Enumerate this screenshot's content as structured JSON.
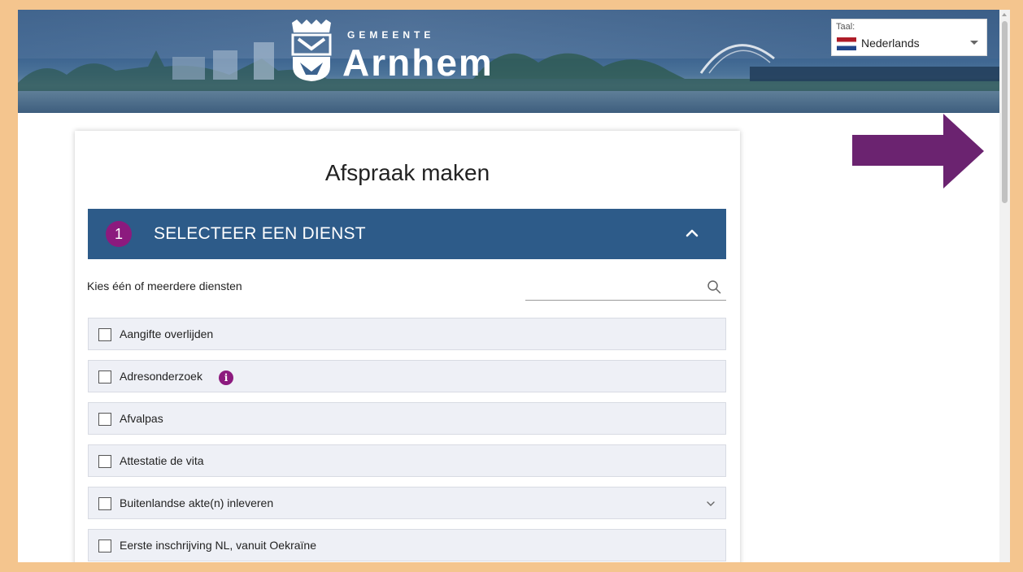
{
  "header": {
    "logo_top": "GEMEENTE",
    "logo_name": "Arnhem"
  },
  "language": {
    "label": "Taal:",
    "selected": "Nederlands",
    "flag_colors": [
      "#ae1c28",
      "#ffffff",
      "#21468b"
    ]
  },
  "page": {
    "title": "Afspraak maken"
  },
  "step": {
    "number": "1",
    "label": "SELECTEER EEN DIENST",
    "badge_color": "#8c1a7e",
    "bar_color": "#2d5b89"
  },
  "filter": {
    "label": "Kies één of meerdere diensten",
    "search_value": "",
    "search_placeholder": ""
  },
  "services": [
    {
      "label": "Aangifte overlijden",
      "checked": false,
      "info": false,
      "expandable": false
    },
    {
      "label": "Adresonderzoek",
      "checked": false,
      "info": true,
      "expandable": false
    },
    {
      "label": "Afvalpas",
      "checked": false,
      "info": false,
      "expandable": false
    },
    {
      "label": "Attestatie de vita",
      "checked": false,
      "info": false,
      "expandable": false
    },
    {
      "label": "Buitenlandse akte(n) inleveren",
      "checked": false,
      "info": false,
      "expandable": true
    },
    {
      "label": "Eerste inschrijving NL, vanuit Oekraïne",
      "checked": false,
      "info": false,
      "expandable": false
    }
  ],
  "icons": {
    "info": "info-icon",
    "search": "search-icon",
    "collapse": "chevron-up-icon",
    "expand": "chevron-down-icon",
    "annotation": "arrow-right-icon"
  },
  "accent_colors": {
    "arrow": "#6b2370",
    "page_border": "#f4c58e"
  }
}
